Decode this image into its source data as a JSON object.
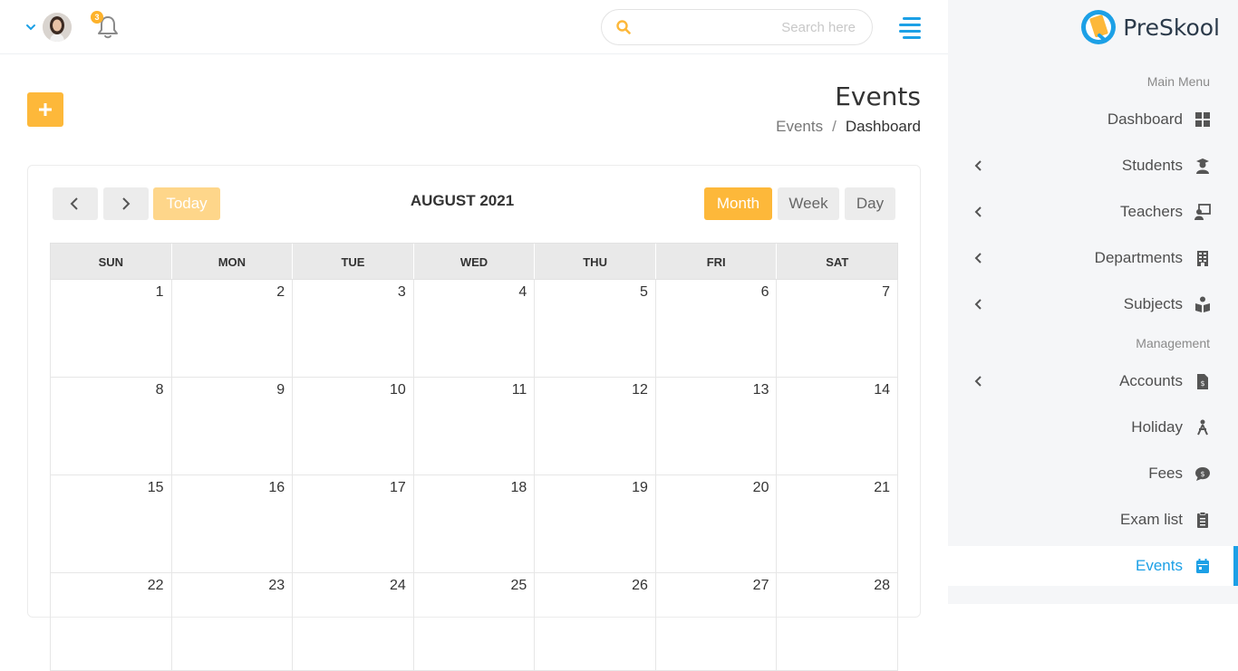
{
  "header": {
    "notification_count": "3",
    "search_placeholder": "Search here"
  },
  "sidebar": {
    "brand": "PreSkool",
    "sections": {
      "main": "Main Menu",
      "management": "Management"
    },
    "items": [
      {
        "label": "Dashboard",
        "icon": "dashboard-icon",
        "has_submenu": false
      },
      {
        "label": "Students",
        "icon": "student-icon",
        "has_submenu": true
      },
      {
        "label": "Teachers",
        "icon": "teacher-icon",
        "has_submenu": true
      },
      {
        "label": "Departments",
        "icon": "building-icon",
        "has_submenu": true
      },
      {
        "label": "Subjects",
        "icon": "book-reader-icon",
        "has_submenu": true
      },
      {
        "label": "Accounts",
        "icon": "invoice-file-icon",
        "has_submenu": true
      },
      {
        "label": "Holiday",
        "icon": "holiday-icon",
        "has_submenu": false
      },
      {
        "label": "Fees",
        "icon": "comment-dollar-icon",
        "has_submenu": false
      },
      {
        "label": "Exam list",
        "icon": "clipboard-list-icon",
        "has_submenu": false
      },
      {
        "label": "Events",
        "icon": "calendar-icon",
        "has_submenu": false,
        "active": true
      }
    ]
  },
  "page": {
    "title": "Events",
    "breadcrumb": [
      "Events",
      "Dashboard"
    ],
    "add_label": "+"
  },
  "calendar": {
    "title": "AUGUST 2021",
    "today_label": "Today",
    "views": [
      "Month",
      "Week",
      "Day"
    ],
    "active_view": "Month",
    "weekdays": [
      "SUN",
      "MON",
      "TUE",
      "WED",
      "THU",
      "FRI",
      "SAT"
    ],
    "weeks": [
      [
        "1",
        "2",
        "3",
        "4",
        "5",
        "6",
        "7"
      ],
      [
        "8",
        "9",
        "10",
        "11",
        "12",
        "13",
        "14"
      ],
      [
        "15",
        "16",
        "17",
        "18",
        "19",
        "20",
        "21"
      ],
      [
        "22",
        "23",
        "24",
        "25",
        "26",
        "27",
        "28"
      ]
    ]
  },
  "colors": {
    "accent": "#fdb83a",
    "primary": "#1ca0e6",
    "sidebar_bg": "#f5f6f8"
  }
}
